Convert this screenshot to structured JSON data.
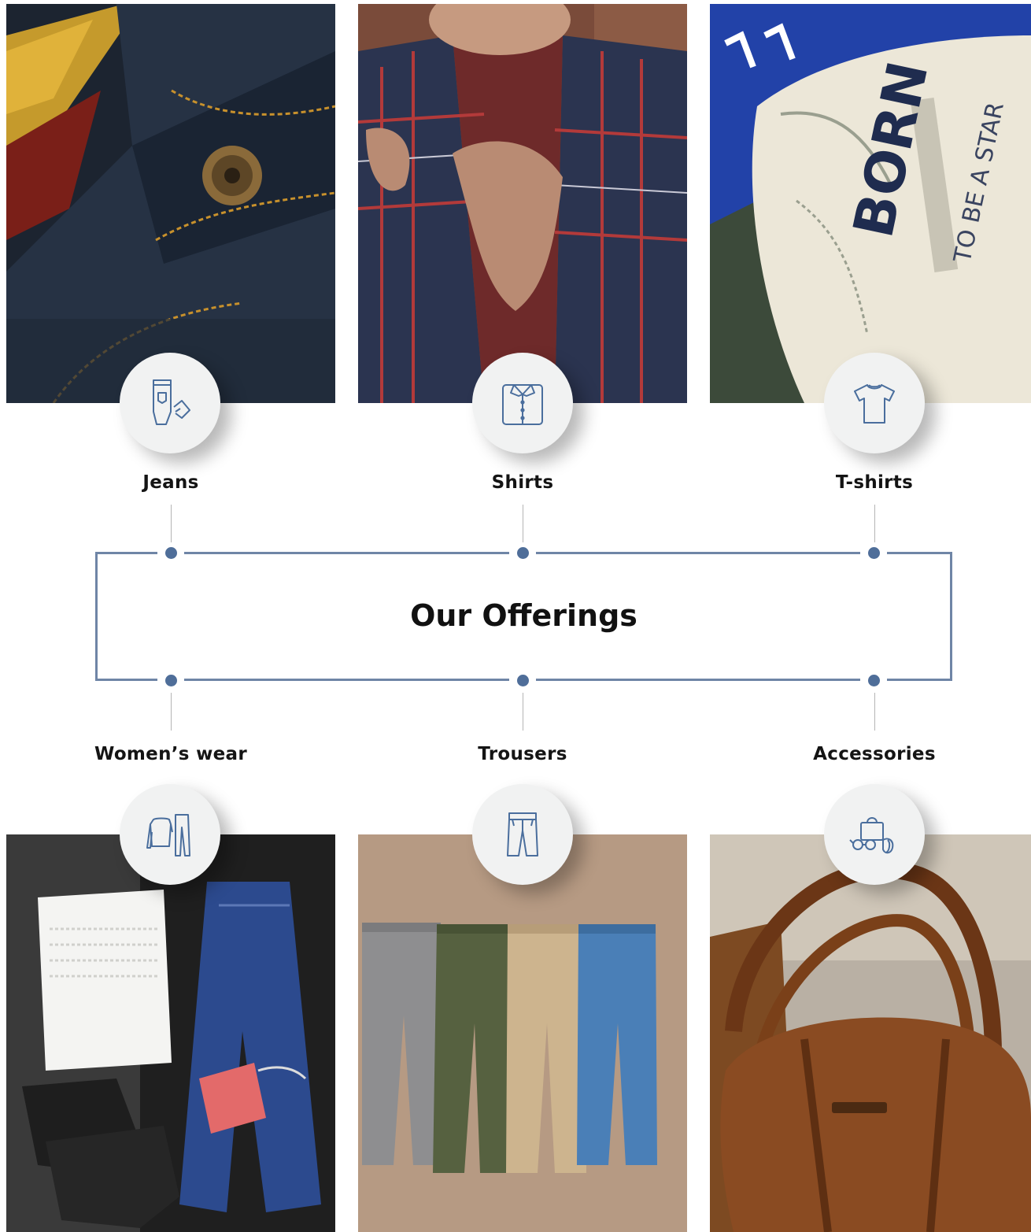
{
  "title": "Our Offerings",
  "offerings_top": [
    {
      "label": "Jeans",
      "icon": "jeans-icon"
    },
    {
      "label": "Shirts",
      "icon": "shirt-icon"
    },
    {
      "label": "T-shirts",
      "icon": "tshirt-icon"
    }
  ],
  "offerings_bottom": [
    {
      "label": "Women’s wear",
      "icon": "womens-wear-icon"
    },
    {
      "label": "Trousers",
      "icon": "trousers-icon"
    },
    {
      "label": "Accessories",
      "icon": "accessories-icon"
    }
  ],
  "colors": {
    "frame": "#6f85a6",
    "dot": "#4f6e99",
    "icon_stroke": "#4a6e9d",
    "badge_bg": "#f1f2f2"
  }
}
